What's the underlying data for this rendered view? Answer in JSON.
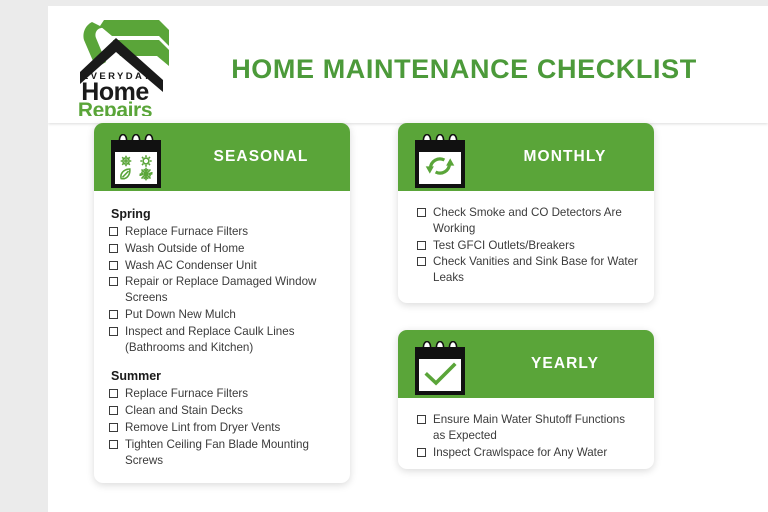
{
  "document": {
    "title": "HOME MAINTENANCE CHECKLIST"
  },
  "brand": {
    "name_line1": "EVERYDAY",
    "name_line2": "Home",
    "name_line3": "Repairs",
    "logo_icon": "house-hammer-logo",
    "green": "#5aa539",
    "dark": "#1a1a1a"
  },
  "colors": {
    "header_green": "#5aa539",
    "title_green": "#4c9a3a",
    "page_background": "#ebebeb",
    "sheet": "#ffffff",
    "text": "#3b3b3b"
  },
  "cards": [
    {
      "id": "seasonal",
      "title": "SEASONAL",
      "icon": "calendar-seasons-icon",
      "sections": [
        {
          "heading": "Spring",
          "items": [
            "Replace Furnace Filters",
            "Wash Outside of Home",
            "Wash AC Condenser Unit",
            "Repair or Replace Damaged Window Screens",
            "Put Down New Mulch",
            "Inspect and Replace Caulk Lines (Bathrooms and Kitchen)"
          ]
        },
        {
          "heading": "Summer",
          "items": [
            "Replace Furnace Filters",
            "Clean and Stain Decks",
            "Remove Lint from Dryer Vents",
            "Tighten Ceiling Fan Blade Mounting Screws"
          ]
        }
      ]
    },
    {
      "id": "monthly",
      "title": "MONTHLY",
      "icon": "calendar-refresh-icon",
      "sections": [
        {
          "heading": "",
          "items": [
            "Check Smoke and CO Detectors Are Working",
            "Test GFCI Outlets/Breakers",
            "Check Vanities and Sink Base for Water Leaks"
          ]
        }
      ]
    },
    {
      "id": "yearly",
      "title": "YEARLY",
      "icon": "calendar-check-icon",
      "sections": [
        {
          "heading": "",
          "items": [
            "Ensure Main Water Shutoff Functions as Expected",
            "Inspect Crawlspace for Any Water"
          ]
        }
      ]
    }
  ]
}
